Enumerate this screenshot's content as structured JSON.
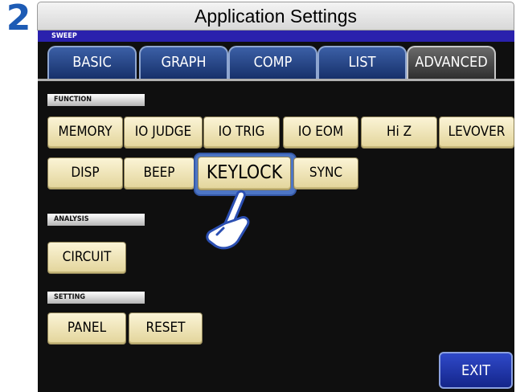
{
  "step_number": "2",
  "window_title": "Application Settings",
  "mode_label": "SWEEP",
  "tabs": [
    {
      "label": "BASIC",
      "active": false
    },
    {
      "label": "GRAPH",
      "active": false
    },
    {
      "label": "COMP",
      "active": false
    },
    {
      "label": "LIST",
      "active": false
    },
    {
      "label": "ADVANCED",
      "active": true
    }
  ],
  "sections": {
    "function": {
      "label": "FUNCTION",
      "row1": [
        "MEMORY",
        "IO JUDGE",
        "IO TRIG",
        "IO EOM",
        "Hi Z",
        "LEVOVER"
      ],
      "row2": [
        "DISP",
        "BEEP",
        "KEYLOCK",
        "SYNC"
      ]
    },
    "analysis": {
      "label": "ANALYSIS",
      "buttons": [
        "CIRCUIT"
      ]
    },
    "setting": {
      "label": "SETTING",
      "buttons": [
        "PANEL",
        "RESET"
      ]
    }
  },
  "exit_label": "EXIT",
  "highlighted_button": "KEYLOCK",
  "colors": {
    "accent": "#1d5bb5",
    "sweep_bar": "#2a21ad",
    "button_face": "#f4ebc0",
    "highlight": "#4d76c5"
  },
  "icons": {
    "pointer": "pointing-hand-icon"
  }
}
